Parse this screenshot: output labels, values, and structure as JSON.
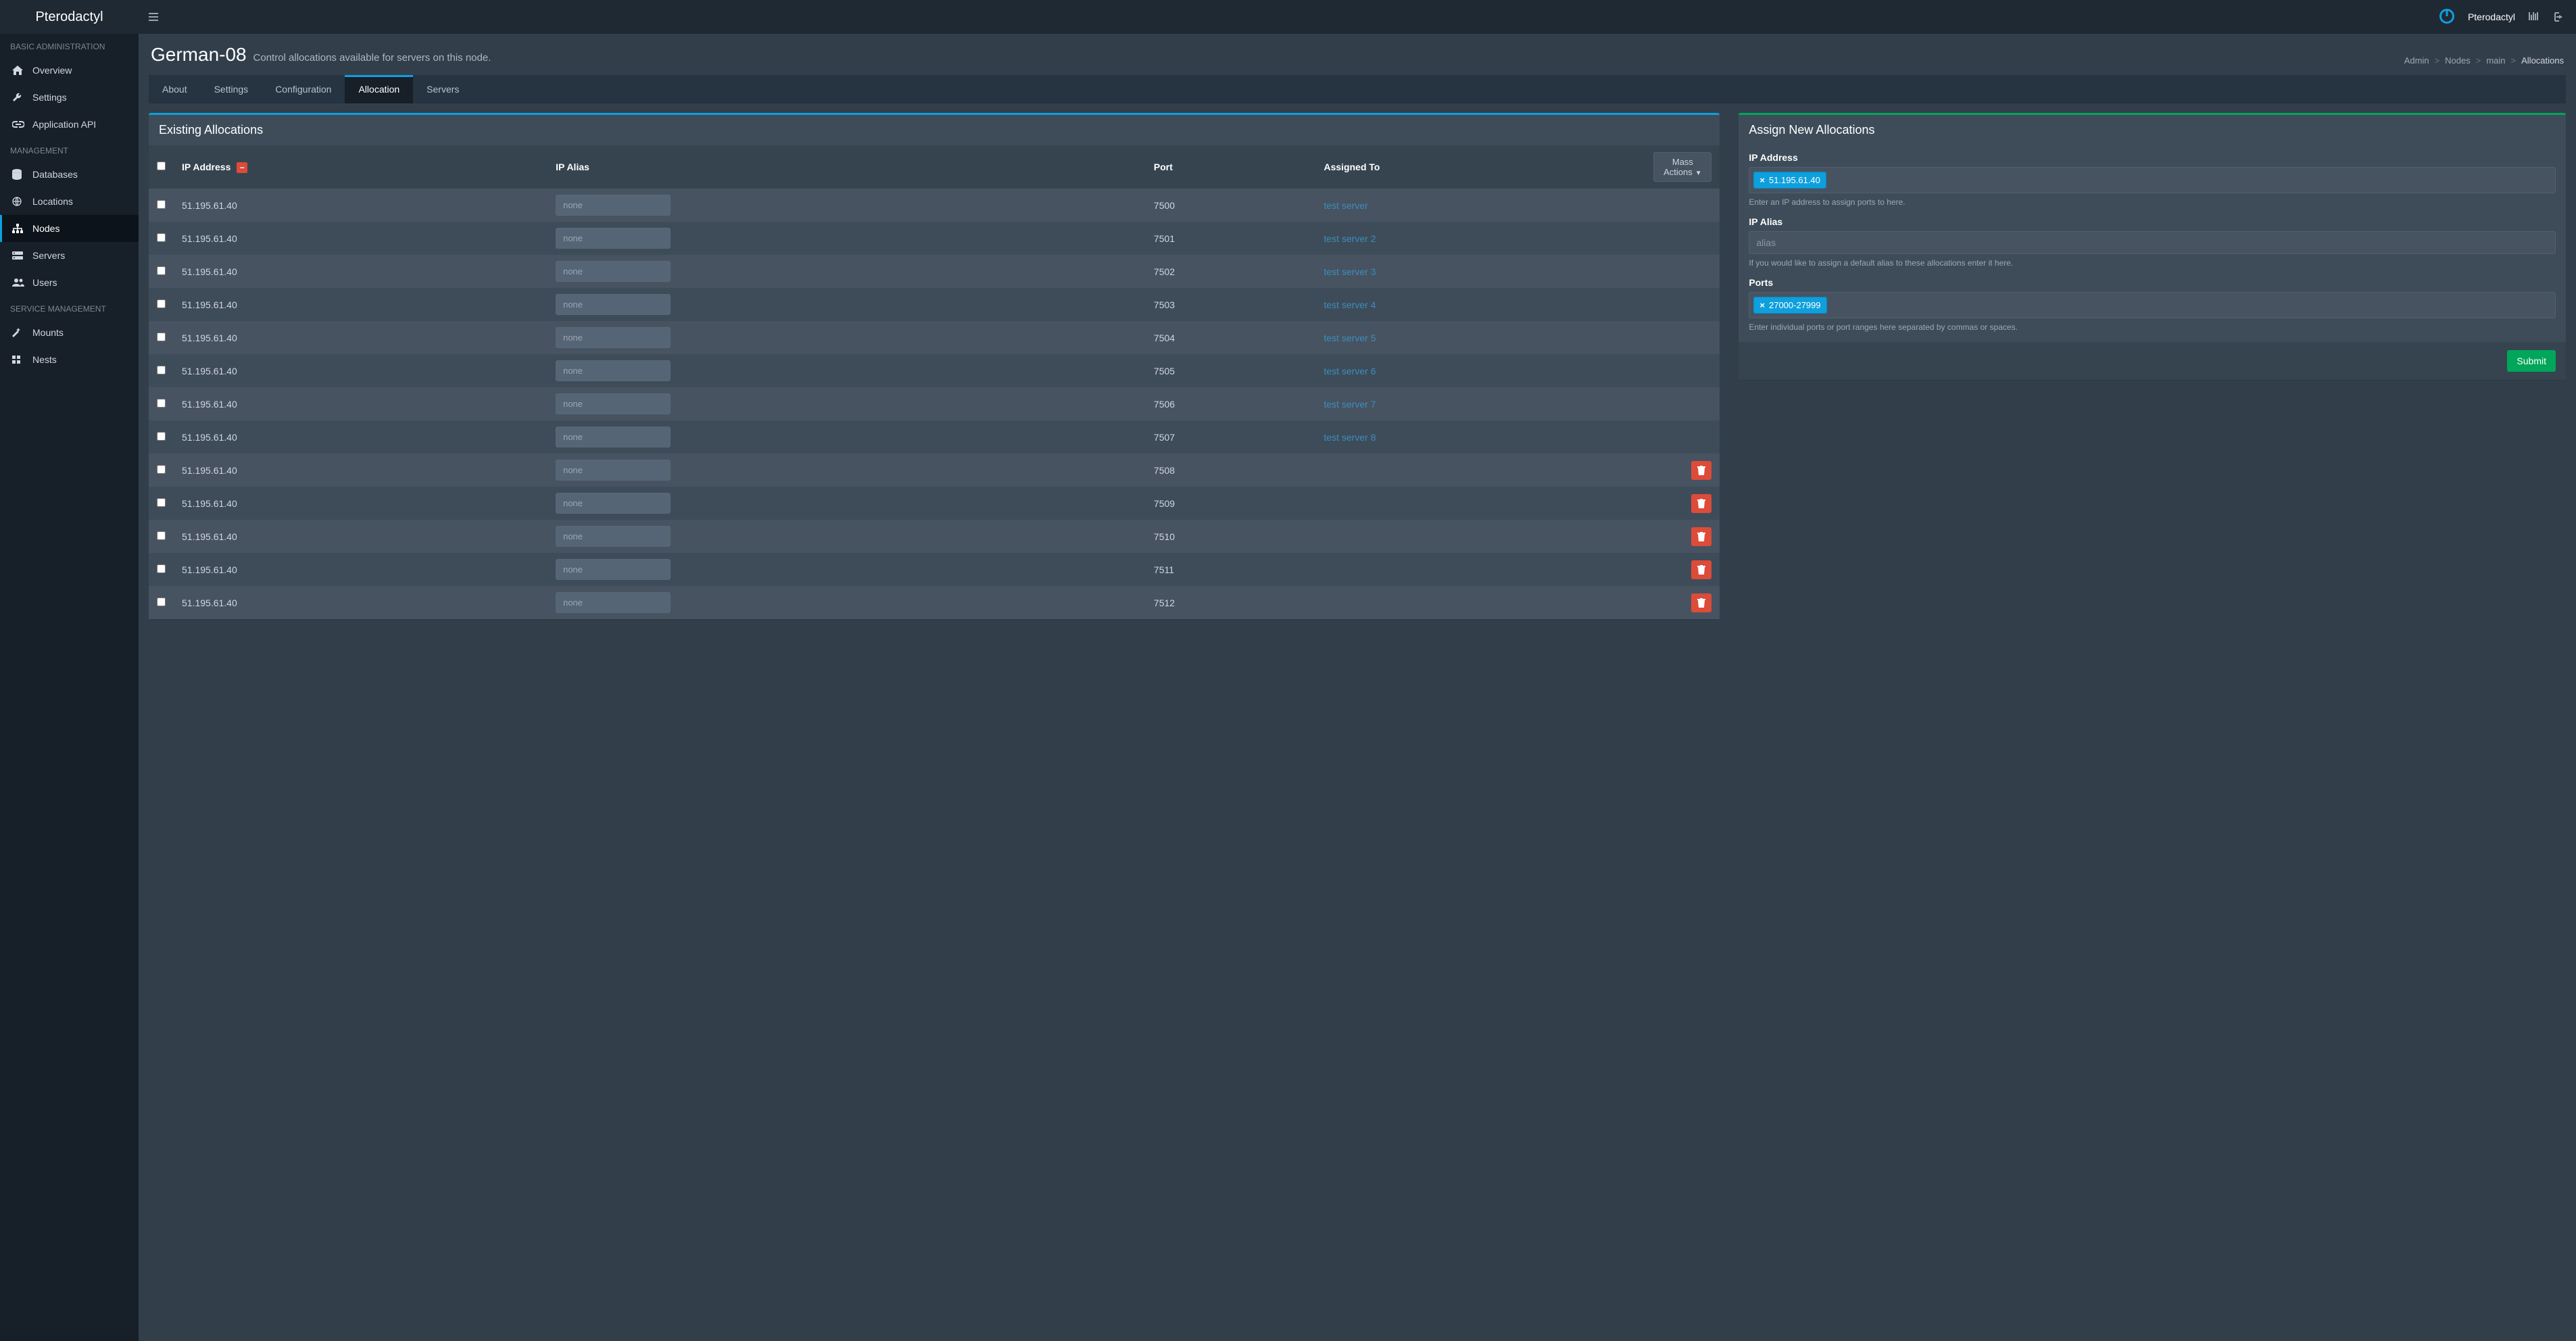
{
  "brand": "Pterodactyl",
  "topnav": {
    "username": "Pterodactyl"
  },
  "sidebar": {
    "sections": [
      {
        "title": "BASIC ADMINISTRATION",
        "items": [
          {
            "icon": "home",
            "label": "Overview",
            "active": false
          },
          {
            "icon": "wrench",
            "label": "Settings",
            "active": false
          },
          {
            "icon": "link",
            "label": "Application API",
            "active": false
          }
        ]
      },
      {
        "title": "MANAGEMENT",
        "items": [
          {
            "icon": "database",
            "label": "Databases",
            "active": false
          },
          {
            "icon": "globe",
            "label": "Locations",
            "active": false
          },
          {
            "icon": "sitemap",
            "label": "Nodes",
            "active": true
          },
          {
            "icon": "server",
            "label": "Servers",
            "active": false
          },
          {
            "icon": "users",
            "label": "Users",
            "active": false
          }
        ]
      },
      {
        "title": "SERVICE MANAGEMENT",
        "items": [
          {
            "icon": "magic",
            "label": "Mounts",
            "active": false
          },
          {
            "icon": "grid",
            "label": "Nests",
            "active": false
          }
        ]
      }
    ]
  },
  "header": {
    "title": "German-08",
    "subtitle": "Control allocations available for servers on this node."
  },
  "breadcrumb": [
    "Admin",
    "Nodes",
    "main",
    "Allocations"
  ],
  "tabs": [
    {
      "label": "About",
      "active": false
    },
    {
      "label": "Settings",
      "active": false
    },
    {
      "label": "Configuration",
      "active": false
    },
    {
      "label": "Allocation",
      "active": true
    },
    {
      "label": "Servers",
      "active": false
    }
  ],
  "existing": {
    "title": "Existing Allocations",
    "columns": {
      "ip": "IP Address",
      "alias": "IP Alias",
      "port": "Port",
      "assigned": "Assigned To"
    },
    "mass_actions": "Mass Actions",
    "alias_placeholder": "none",
    "rows": [
      {
        "ip": "51.195.61.40",
        "port": "7500",
        "server": "test server"
      },
      {
        "ip": "51.195.61.40",
        "port": "7501",
        "server": "test server 2"
      },
      {
        "ip": "51.195.61.40",
        "port": "7502",
        "server": "test server 3"
      },
      {
        "ip": "51.195.61.40",
        "port": "7503",
        "server": "test server 4"
      },
      {
        "ip": "51.195.61.40",
        "port": "7504",
        "server": "test server 5"
      },
      {
        "ip": "51.195.61.40",
        "port": "7505",
        "server": "test server 6"
      },
      {
        "ip": "51.195.61.40",
        "port": "7506",
        "server": "test server 7"
      },
      {
        "ip": "51.195.61.40",
        "port": "7507",
        "server": "test server 8"
      },
      {
        "ip": "51.195.61.40",
        "port": "7508",
        "server": null
      },
      {
        "ip": "51.195.61.40",
        "port": "7509",
        "server": null
      },
      {
        "ip": "51.195.61.40",
        "port": "7510",
        "server": null
      },
      {
        "ip": "51.195.61.40",
        "port": "7511",
        "server": null
      },
      {
        "ip": "51.195.61.40",
        "port": "7512",
        "server": null
      }
    ]
  },
  "assign": {
    "title": "Assign New Allocations",
    "ip_label": "IP Address",
    "ip_tag": "51.195.61.40",
    "ip_help": "Enter an IP address to assign ports to here.",
    "alias_label": "IP Alias",
    "alias_placeholder": "alias",
    "alias_help": "If you would like to assign a default alias to these allocations enter it here.",
    "ports_label": "Ports",
    "ports_tag": "27000-27999",
    "ports_help": "Enter individual ports or port ranges here separated by commas or spaces.",
    "submit": "Submit"
  }
}
